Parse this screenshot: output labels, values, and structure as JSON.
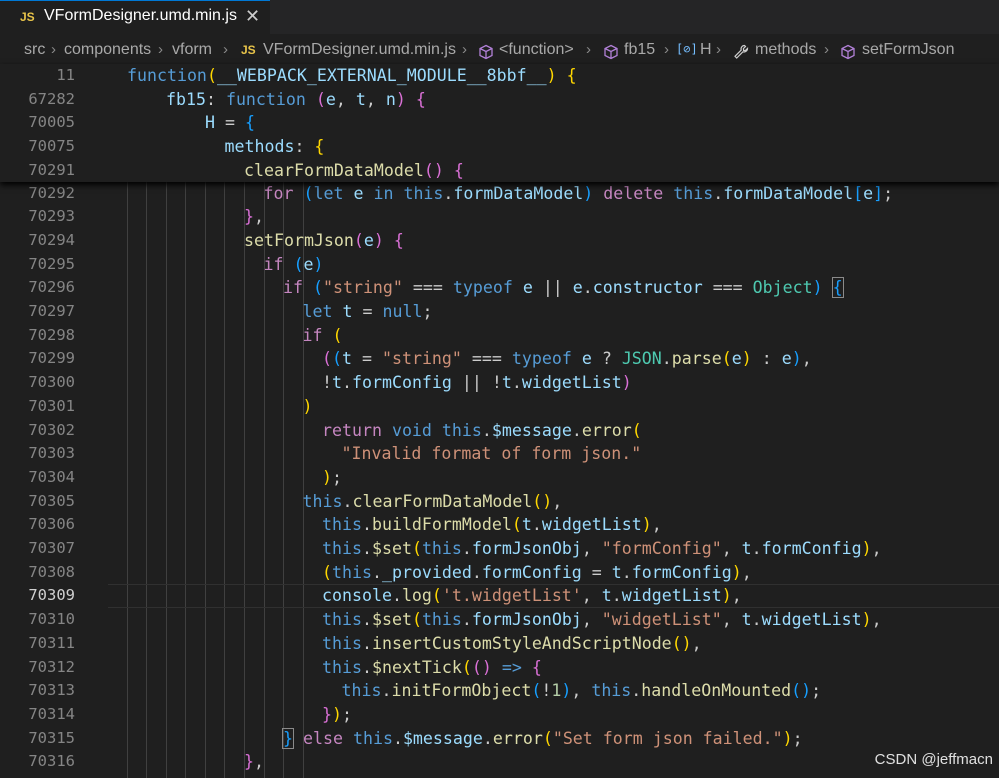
{
  "tab": {
    "badge": "JS",
    "filename": "VFormDesigner.umd.min.js",
    "close_glyph": "✕"
  },
  "breadcrumb": {
    "items": [
      "src",
      "components",
      "vform",
      "VFormDesigner.umd.min.js",
      "<function>",
      "fb15",
      "H",
      "methods",
      "setFormJson"
    ],
    "separator": "›",
    "file_badge": "JS",
    "icons": [
      "file-js-icon",
      "method-cube-icon",
      "method-cube-icon",
      "variable-bracket-icon",
      "wrench-icon",
      "method-cube-icon"
    ]
  },
  "sticky_lines": [
    {
      "num": "11",
      "tokens": [
        [
          "k",
          "function"
        ],
        [
          "",
          ""
        ],
        [
          "p1",
          "("
        ],
        [
          "v",
          "__WEBPACK_EXTERNAL_MODULE__8bbf__"
        ],
        [
          "p1",
          ")"
        ],
        [
          "",
          " "
        ],
        [
          "p1",
          "{"
        ]
      ]
    },
    {
      "num": "67282",
      "tokens": [
        [
          "v",
          "fb15"
        ],
        [
          "",
          ": "
        ],
        [
          "k",
          "function"
        ],
        [
          "",
          " "
        ],
        [
          "p2",
          "("
        ],
        [
          "v",
          "e"
        ],
        [
          "",
          ", "
        ],
        [
          "v",
          "t"
        ],
        [
          "",
          ", "
        ],
        [
          "v",
          "n"
        ],
        [
          "p2",
          ")"
        ],
        [
          "",
          " "
        ],
        [
          "p2",
          "{"
        ]
      ]
    },
    {
      "num": "70005",
      "tokens": [
        [
          "v",
          "H"
        ],
        [
          "",
          " = "
        ],
        [
          "p3",
          "{"
        ]
      ]
    },
    {
      "num": "70075",
      "tokens": [
        [
          "v",
          "methods"
        ],
        [
          "",
          ": "
        ],
        [
          "p1",
          "{"
        ]
      ]
    },
    {
      "num": "70291",
      "tokens": [
        [
          "f",
          "clearFormDataModel"
        ],
        [
          "p2",
          "()"
        ],
        [
          "",
          " "
        ],
        [
          "p2",
          "{"
        ]
      ]
    }
  ],
  "lines": [
    {
      "num": "70292",
      "tokens": [
        [
          "c",
          "for"
        ],
        [
          "",
          " "
        ],
        [
          "p3",
          "("
        ],
        [
          "k",
          "let"
        ],
        [
          "",
          " "
        ],
        [
          "v",
          "e"
        ],
        [
          "",
          " "
        ],
        [
          "k",
          "in"
        ],
        [
          "",
          " "
        ],
        [
          "k",
          "this"
        ],
        [
          "",
          "."
        ],
        [
          "v",
          "formDataModel"
        ],
        [
          "p3",
          ")"
        ],
        [
          "",
          " "
        ],
        [
          "c",
          "delete"
        ],
        [
          "",
          " "
        ],
        [
          "k",
          "this"
        ],
        [
          "",
          "."
        ],
        [
          "v",
          "formDataModel"
        ],
        [
          "p3",
          "["
        ],
        [
          "v",
          "e"
        ],
        [
          "p3",
          "]"
        ],
        [
          "",
          ";"
        ]
      ]
    },
    {
      "num": "70293",
      "tokens": [
        [
          "p2",
          "}"
        ],
        [
          "",
          ","
        ]
      ]
    },
    {
      "num": "70294",
      "tokens": [
        [
          "f",
          "setFormJson"
        ],
        [
          "p2",
          "("
        ],
        [
          "v",
          "e"
        ],
        [
          "p2",
          ")"
        ],
        [
          "",
          " "
        ],
        [
          "p2",
          "{"
        ]
      ]
    },
    {
      "num": "70295",
      "tokens": [
        [
          "c",
          "if"
        ],
        [
          "",
          " "
        ],
        [
          "p3",
          "("
        ],
        [
          "v",
          "e"
        ],
        [
          "p3",
          ")"
        ]
      ]
    },
    {
      "num": "70296",
      "tokens": [
        [
          "c",
          "if"
        ],
        [
          "",
          " "
        ],
        [
          "p3",
          "("
        ],
        [
          "s",
          "\"string\""
        ],
        [
          "",
          " === "
        ],
        [
          "k",
          "typeof"
        ],
        [
          "",
          " "
        ],
        [
          "v",
          "e"
        ],
        [
          "",
          " || "
        ],
        [
          "v",
          "e"
        ],
        [
          "",
          "."
        ],
        [
          "v",
          "constructor"
        ],
        [
          "",
          " === "
        ],
        [
          "t",
          "Object"
        ],
        [
          "p3",
          ")"
        ],
        [
          "",
          " "
        ],
        [
          "p3mb",
          "{"
        ]
      ]
    },
    {
      "num": "70297",
      "tokens": [
        [
          "k",
          "let"
        ],
        [
          "",
          " "
        ],
        [
          "v",
          "t"
        ],
        [
          "",
          " = "
        ],
        [
          "k",
          "null"
        ],
        [
          "",
          ";"
        ]
      ]
    },
    {
      "num": "70298",
      "tokens": [
        [
          "c",
          "if"
        ],
        [
          "",
          " "
        ],
        [
          "p1",
          "("
        ]
      ]
    },
    {
      "num": "70299",
      "tokens": [
        [
          "p2",
          "("
        ],
        [
          "p3",
          "("
        ],
        [
          "v",
          "t"
        ],
        [
          "",
          " = "
        ],
        [
          "s",
          "\"string\""
        ],
        [
          "",
          " === "
        ],
        [
          "k",
          "typeof"
        ],
        [
          "",
          " "
        ],
        [
          "v",
          "e"
        ],
        [
          "",
          " ? "
        ],
        [
          "t",
          "JSON"
        ],
        [
          "",
          "."
        ],
        [
          "f",
          "parse"
        ],
        [
          "p1",
          "("
        ],
        [
          "v",
          "e"
        ],
        [
          "p1",
          ")"
        ],
        [
          "",
          " : "
        ],
        [
          "v",
          "e"
        ],
        [
          "p3",
          ")"
        ],
        [
          "",
          ","
        ]
      ]
    },
    {
      "num": "70300",
      "tokens": [
        [
          "",
          "!"
        ],
        [
          "v",
          "t"
        ],
        [
          "",
          "."
        ],
        [
          "v",
          "formConfig"
        ],
        [
          "",
          " || !"
        ],
        [
          "v",
          "t"
        ],
        [
          "",
          "."
        ],
        [
          "v",
          "widgetList"
        ],
        [
          "p2",
          ")"
        ]
      ]
    },
    {
      "num": "70301",
      "tokens": [
        [
          "p1",
          ")"
        ]
      ]
    },
    {
      "num": "70302",
      "tokens": [
        [
          "c",
          "return"
        ],
        [
          "",
          " "
        ],
        [
          "k",
          "void"
        ],
        [
          "",
          " "
        ],
        [
          "k",
          "this"
        ],
        [
          "",
          "."
        ],
        [
          "v",
          "$message"
        ],
        [
          "",
          "."
        ],
        [
          "f",
          "error"
        ],
        [
          "p1",
          "("
        ]
      ]
    },
    {
      "num": "70303",
      "tokens": [
        [
          "s",
          "\"Invalid format of form json.\""
        ]
      ]
    },
    {
      "num": "70304",
      "tokens": [
        [
          "p1",
          ")"
        ],
        [
          "",
          ";"
        ]
      ]
    },
    {
      "num": "70305",
      "tokens": [
        [
          "k",
          "this"
        ],
        [
          "",
          "."
        ],
        [
          "f",
          "clearFormDataModel"
        ],
        [
          "p1",
          "()"
        ],
        [
          "",
          ","
        ]
      ]
    },
    {
      "num": "70306",
      "tokens": [
        [
          "k",
          "this"
        ],
        [
          "",
          "."
        ],
        [
          "f",
          "buildFormModel"
        ],
        [
          "p1",
          "("
        ],
        [
          "v",
          "t"
        ],
        [
          "",
          "."
        ],
        [
          "v",
          "widgetList"
        ],
        [
          "p1",
          ")"
        ],
        [
          "",
          ","
        ]
      ]
    },
    {
      "num": "70307",
      "tokens": [
        [
          "k",
          "this"
        ],
        [
          "",
          "."
        ],
        [
          "f",
          "$set"
        ],
        [
          "p1",
          "("
        ],
        [
          "k",
          "this"
        ],
        [
          "",
          "."
        ],
        [
          "v",
          "formJsonObj"
        ],
        [
          "",
          ", "
        ],
        [
          "s",
          "\"formConfig\""
        ],
        [
          "",
          ", "
        ],
        [
          "v",
          "t"
        ],
        [
          "",
          "."
        ],
        [
          "v",
          "formConfig"
        ],
        [
          "p1",
          ")"
        ],
        [
          "",
          ","
        ]
      ]
    },
    {
      "num": "70308",
      "tokens": [
        [
          "p1",
          "("
        ],
        [
          "k",
          "this"
        ],
        [
          "",
          "."
        ],
        [
          "v",
          "_provided"
        ],
        [
          "",
          "."
        ],
        [
          "v",
          "formConfig"
        ],
        [
          "",
          " = "
        ],
        [
          "v",
          "t"
        ],
        [
          "",
          "."
        ],
        [
          "v",
          "formConfig"
        ],
        [
          "p1",
          ")"
        ],
        [
          "",
          ","
        ]
      ]
    },
    {
      "num": "70309",
      "tokens": [
        [
          "v",
          "console"
        ],
        [
          "",
          "."
        ],
        [
          "f",
          "log"
        ],
        [
          "p1",
          "("
        ],
        [
          "s",
          "'t.widgetList'"
        ],
        [
          "",
          ", "
        ],
        [
          "v",
          "t"
        ],
        [
          "",
          "."
        ],
        [
          "v",
          "widgetList"
        ],
        [
          "p1",
          ")"
        ],
        [
          "",
          ","
        ]
      ],
      "current": true
    },
    {
      "num": "70310",
      "tokens": [
        [
          "k",
          "this"
        ],
        [
          "",
          "."
        ],
        [
          "f",
          "$set"
        ],
        [
          "p1",
          "("
        ],
        [
          "k",
          "this"
        ],
        [
          "",
          "."
        ],
        [
          "v",
          "formJsonObj"
        ],
        [
          "",
          ", "
        ],
        [
          "s",
          "\"widgetList\""
        ],
        [
          "",
          ", "
        ],
        [
          "v",
          "t"
        ],
        [
          "",
          "."
        ],
        [
          "v",
          "widgetList"
        ],
        [
          "p1",
          ")"
        ],
        [
          "",
          ","
        ]
      ]
    },
    {
      "num": "70311",
      "tokens": [
        [
          "k",
          "this"
        ],
        [
          "",
          "."
        ],
        [
          "f",
          "insertCustomStyleAndScriptNode"
        ],
        [
          "p1",
          "()"
        ],
        [
          "",
          ","
        ]
      ]
    },
    {
      "num": "70312",
      "tokens": [
        [
          "k",
          "this"
        ],
        [
          "",
          "."
        ],
        [
          "f",
          "$nextTick"
        ],
        [
          "p1",
          "("
        ],
        [
          "p2",
          "()"
        ],
        [
          "",
          " "
        ],
        [
          "k",
          "=>"
        ],
        [
          "",
          " "
        ],
        [
          "p2",
          "{"
        ]
      ]
    },
    {
      "num": "70313",
      "tokens": [
        [
          "k",
          "this"
        ],
        [
          "",
          "."
        ],
        [
          "f",
          "initFormObject"
        ],
        [
          "p3",
          "("
        ],
        [
          "",
          "!"
        ],
        [
          "n",
          "1"
        ],
        [
          "p3",
          ")"
        ],
        [
          "",
          ", "
        ],
        [
          "k",
          "this"
        ],
        [
          "",
          "."
        ],
        [
          "f",
          "handleOnMounted"
        ],
        [
          "p3",
          "()"
        ],
        [
          "",
          ";"
        ]
      ]
    },
    {
      "num": "70314",
      "tokens": [
        [
          "p2",
          "}"
        ],
        [
          "p1",
          ")"
        ],
        [
          "",
          ";"
        ]
      ]
    },
    {
      "num": "70315",
      "tokens": [
        [
          "p3mb",
          "}"
        ],
        [
          "",
          " "
        ],
        [
          "c",
          "else"
        ],
        [
          "",
          " "
        ],
        [
          "k",
          "this"
        ],
        [
          "",
          "."
        ],
        [
          "v",
          "$message"
        ],
        [
          "",
          "."
        ],
        [
          "f",
          "error"
        ],
        [
          "p1",
          "("
        ],
        [
          "s",
          "\"Set form json failed.\""
        ],
        [
          "p1",
          ")"
        ],
        [
          "",
          ";"
        ]
      ]
    },
    {
      "num": "70316",
      "tokens": [
        [
          "p2",
          "}"
        ],
        [
          "",
          ","
        ]
      ]
    }
  ],
  "watermark": "CSDN @jeffmacn",
  "colors": {
    "background": "#1f1f1f",
    "keyword": "#569cd6",
    "control": "#c586c0",
    "function": "#dcdcaa",
    "string": "#ce9178",
    "variable": "#9cdcfe",
    "type": "#4ec9b0"
  }
}
